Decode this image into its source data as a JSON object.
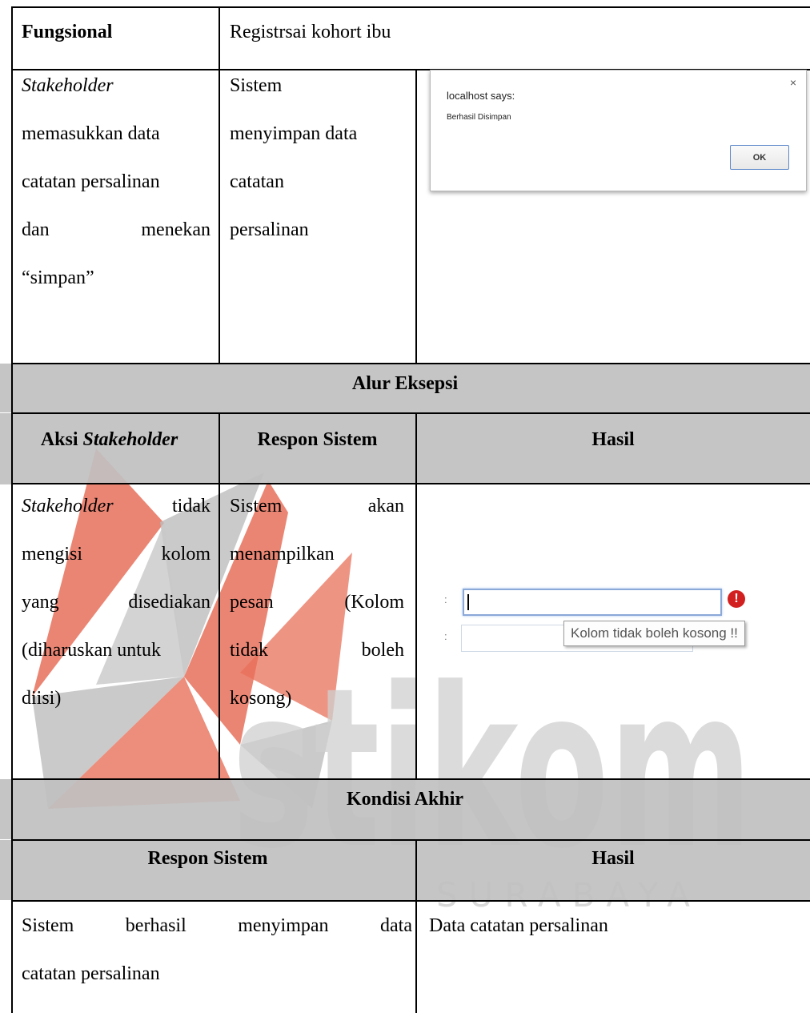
{
  "watermark": {
    "logo_text": "stikom",
    "sub_text": "SURABAYA",
    "colors": {
      "red": "#e8705a",
      "gray": "#bdbdbd",
      "logo_text": "#d0d0d0"
    }
  },
  "row_fungsional": {
    "label": "Fungsional",
    "value": "Registrsai kohort ibu"
  },
  "row_normal": {
    "stakeholder_lines": [
      "Stakeholder",
      "memasukkan data",
      "catatan persalinan",
      [
        "dan",
        "menekan"
      ],
      "“simpan”"
    ],
    "system_lines": [
      "Sistem",
      "menyimpan data",
      "catatan",
      "persalinan"
    ]
  },
  "dialog": {
    "title": "localhost says:",
    "message": "Berhasil Disimpan",
    "ok_label": "OK",
    "close_glyph": "×"
  },
  "alur_eksepsi": {
    "heading": "Alur Eksepsi",
    "col_aksi_prefix": "Aksi ",
    "col_aksi_italic": "Stakeholder",
    "col_respon": "Respon Sistem",
    "col_hasil": "Hasil",
    "stakeholder_first_italic": "Stakeholder",
    "stakeholder_first_rest": "tidak",
    "stakeholder_lines": [
      [
        "mengisi",
        "kolom"
      ],
      [
        "yang",
        "disediakan"
      ],
      "(diharuskan untuk",
      "diisi)"
    ],
    "system_lines": [
      [
        "Sistem",
        "akan"
      ],
      "menampilkan",
      [
        "pesan",
        "(Kolom"
      ],
      [
        "tidak",
        "boleh"
      ],
      "kosong)"
    ],
    "form": {
      "colon": ":",
      "error_glyph": "!",
      "tooltip": "Kolom tidak boleh kosong !!"
    }
  },
  "kondisi_akhir": {
    "heading": "Kondisi Akhir",
    "col_respon": "Respon Sistem",
    "col_hasil": "Hasil",
    "respon_lines": [
      [
        "Sistem",
        "berhasil",
        "menyimpan",
        "data"
      ],
      "catatan persalinan"
    ],
    "hasil_lines": [
      "Data catatan persalinan"
    ]
  }
}
